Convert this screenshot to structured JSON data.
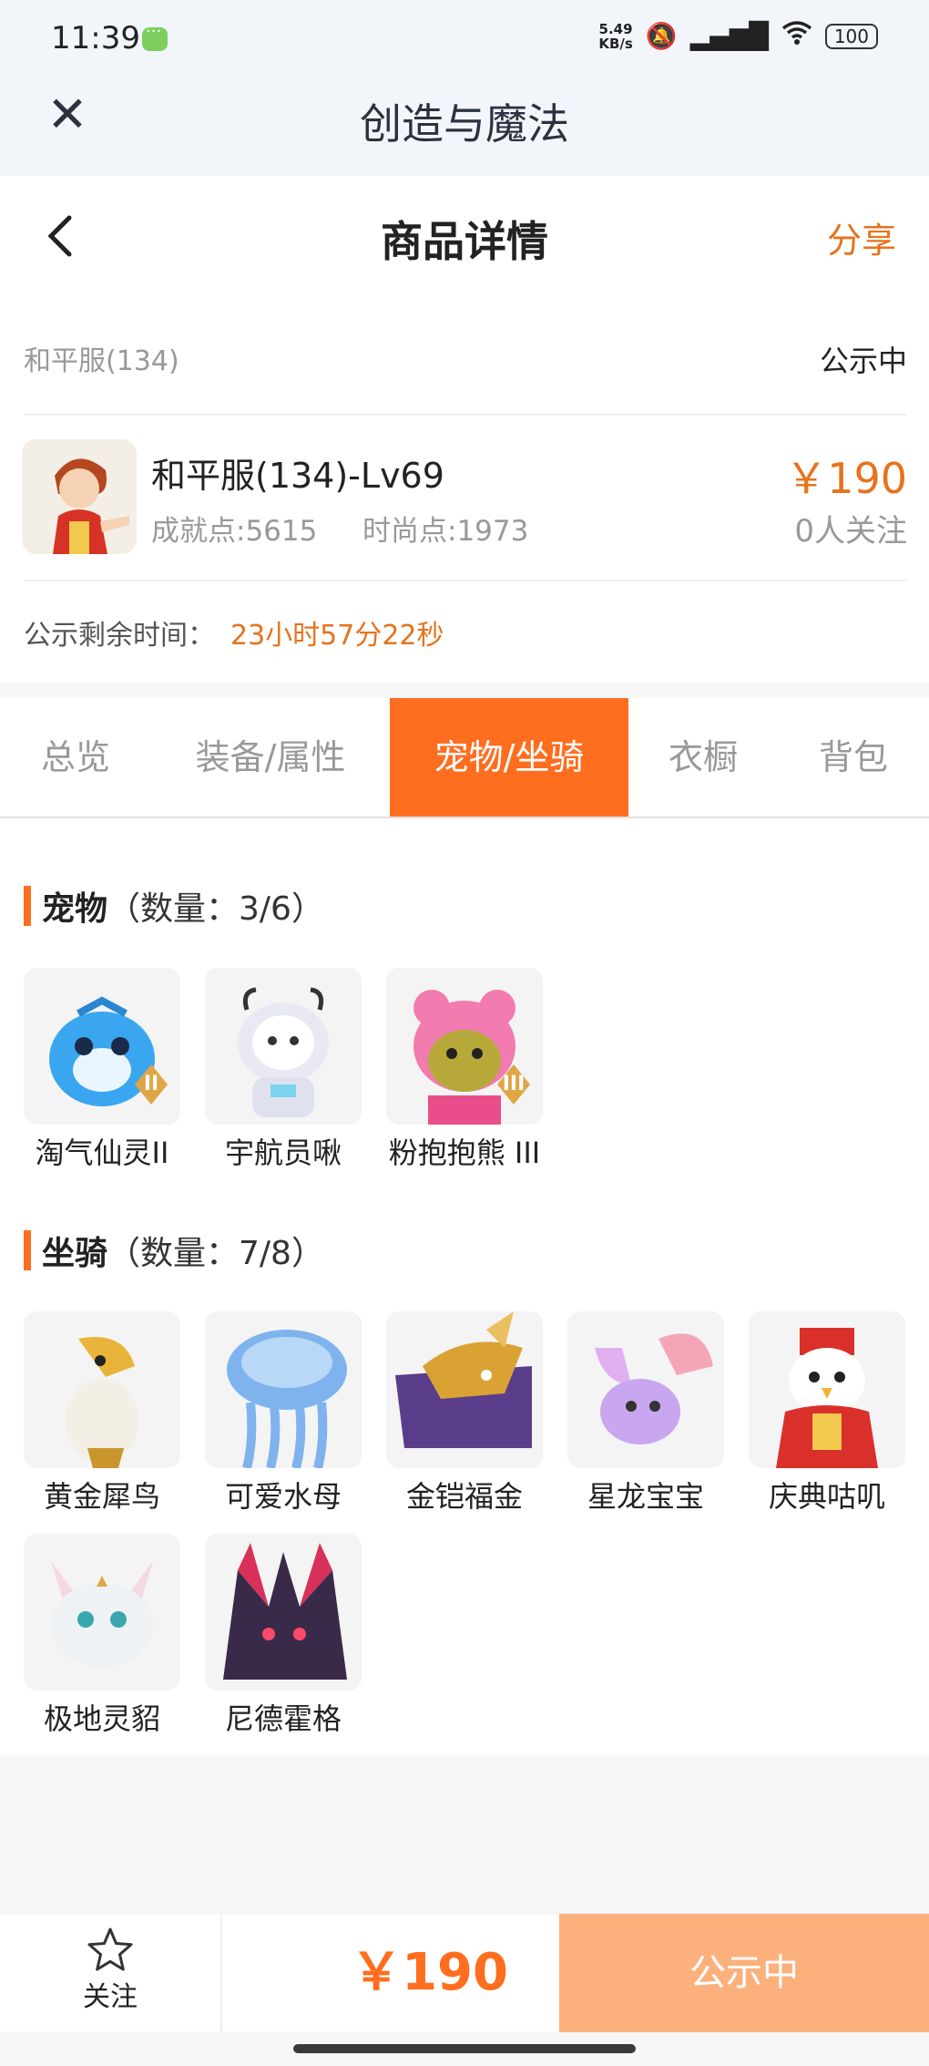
{
  "status_bar": {
    "time": "11:39",
    "net_speed_value": "5.49",
    "net_speed_unit": "KB/s",
    "icons": [
      "mute-bell-icon",
      "hd-signal-icon",
      "wifi-icon"
    ],
    "battery": "100"
  },
  "app": {
    "title": "创造与魔法",
    "close_icon": "close-icon"
  },
  "header": {
    "title": "商品详情",
    "share": "分享",
    "back_icon": "chevron-left-icon"
  },
  "product": {
    "server": "和平服(134)",
    "status": "公示中",
    "role_name": "和平服(134)-Lv69",
    "achievement": "成就点:5615",
    "fashion": "时尚点:1973",
    "price": "￥190",
    "followers": "0人关注",
    "remain_label": "公示剩余时间：",
    "remain_value": "23小时57分22秒"
  },
  "tabs": [
    {
      "label": "总览",
      "active": false
    },
    {
      "label": "装备/属性",
      "active": false
    },
    {
      "label": "宠物/坐骑",
      "active": true
    },
    {
      "label": "衣橱",
      "active": false
    },
    {
      "label": "背包",
      "active": false
    }
  ],
  "pets": {
    "title": "宠物",
    "count": "（数量：3/6）",
    "items": [
      {
        "name": "淘气仙灵II",
        "badge": "II",
        "color": "#3aa6f0"
      },
      {
        "name": "宇航员啾",
        "badge": "",
        "color": "#e9e9f4"
      },
      {
        "name": "粉抱抱熊 III",
        "badge": "III",
        "color": "#f27bb0"
      }
    ]
  },
  "mounts": {
    "title": "坐骑",
    "count": "（数量：7/8）",
    "items": [
      {
        "name": "黄金犀鸟",
        "color": "#e8b53a"
      },
      {
        "name": "可爱水母",
        "color": "#7fb3ee"
      },
      {
        "name": "金铠福金",
        "color": "#5a3d8a"
      },
      {
        "name": "星龙宝宝",
        "color": "#c9a6f0"
      },
      {
        "name": "庆典咕叽",
        "color": "#d9302c"
      },
      {
        "name": "极地灵貂",
        "color": "#eef2f5"
      },
      {
        "name": "尼德霍格",
        "color": "#3a2a4a"
      }
    ]
  },
  "bottom_bar": {
    "follow": "关注",
    "price": "￥190",
    "action": "公示中"
  },
  "colors": {
    "accent": "#ff6d1f",
    "price": "#e6731e",
    "button_disabled": "#fcb07c"
  }
}
